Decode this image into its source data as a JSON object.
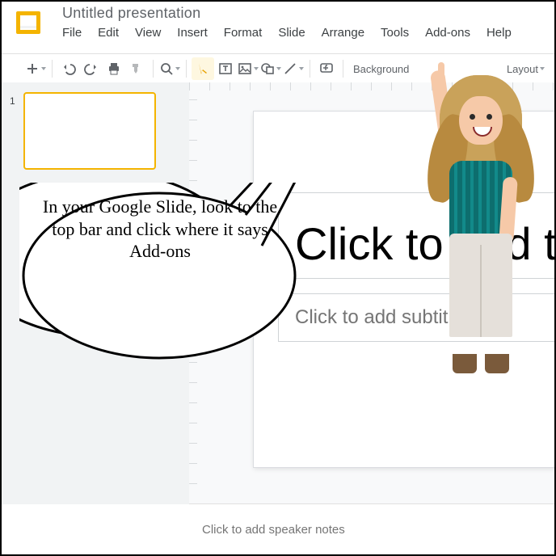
{
  "doc": {
    "title": "Untitled presentation"
  },
  "menu": {
    "file": "File",
    "edit": "Edit",
    "view": "View",
    "insert": "Insert",
    "format": "Format",
    "slide": "Slide",
    "arrange": "Arrange",
    "tools": "Tools",
    "addons": "Add-ons",
    "help": "Help"
  },
  "toolbar": {
    "background": "Background",
    "layout": "Layout"
  },
  "filmstrip": {
    "slides": [
      {
        "number": "1"
      }
    ]
  },
  "slide": {
    "title": "Click to add title",
    "subtitle": "Click to add subtitle"
  },
  "notes": {
    "placeholder": "Click to add speaker notes"
  },
  "bubble": {
    "text": "In your Google Slide, look to the top bar and click where it says Add-ons"
  }
}
